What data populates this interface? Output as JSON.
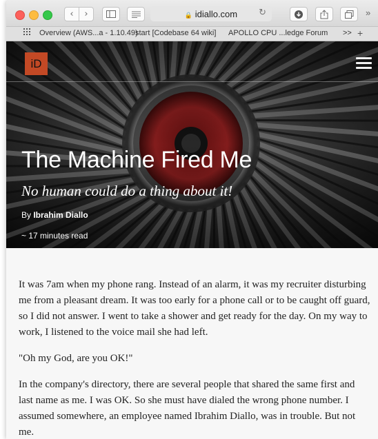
{
  "browser": {
    "address": "idiallo.com",
    "lock_glyph": "🔒",
    "bookmarks": [
      "Overview (AWS...a - 1.10.49)",
      "start [Codebase 64 wiki]",
      "APOLLO CPU ...ledge Forum"
    ],
    "bookmarks_overflow": ">>"
  },
  "site": {
    "logo_text": "iD"
  },
  "hero": {
    "title": "The Machine Fired Me",
    "subtitle": "No human could do a thing about it!",
    "by_prefix": "By ",
    "author": "Ibrahim Diallo",
    "read_time": "~ 17 minutes read"
  },
  "article": {
    "paragraphs": [
      "It was 7am when my phone rang. Instead of an alarm, it was my recruiter disturbing me from a pleasant dream. It was too early for a phone call or to be caught off guard, so I did not answer. I went to take a shower and get ready for the day. On my way to work, I listened to the voice mail she had left.",
      "\"Oh my God, are you OK!\"",
      "In the company's directory, there are several people that shared the same first and last name as me. I was OK. So she must have dialed the wrong phone number. I assumed somewhere, an employee named Ibrahim Diallo, was in trouble. But not me."
    ]
  },
  "colors": {
    "accent": "#c34925",
    "close": "#fc605b",
    "minimize": "#fdbc40",
    "zoom": "#34c84a"
  }
}
